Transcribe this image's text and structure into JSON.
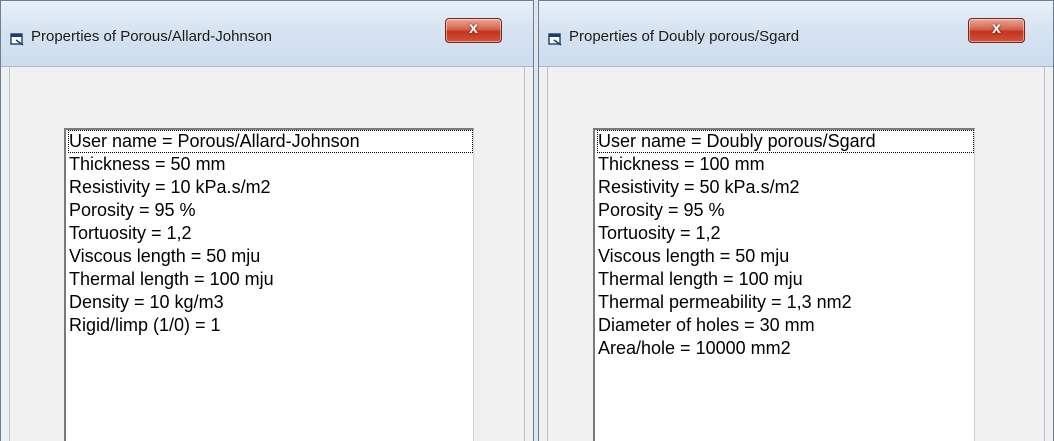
{
  "left_window": {
    "title": "Properties of  Porous/Allard-Johnson",
    "close_label": "x",
    "items": [
      "User name = Porous/Allard-Johnson",
      "Thickness = 50  mm",
      "Resistivity = 10  kPa.s/m2",
      "Porosity = 95  %",
      "Tortuosity = 1,2",
      "Viscous length = 50  mju",
      "Thermal length = 100  mju",
      "Density = 10  kg/m3",
      "Rigid/limp (1/0) = 1"
    ]
  },
  "right_window": {
    "title": "Properties of  Doubly porous/Sgard",
    "close_label": "x",
    "items": [
      "User name = Doubly porous/Sgard",
      "Thickness = 100  mm",
      "Resistivity = 50  kPa.s/m2",
      "Porosity = 95  %",
      "Tortuosity = 1,2",
      "Viscous length = 50  mju",
      "Thermal length = 100  mju",
      "Thermal permeability = 1,3  nm2",
      "Diameter of holes = 30  mm",
      "Area/hole = 10000  mm2"
    ]
  }
}
